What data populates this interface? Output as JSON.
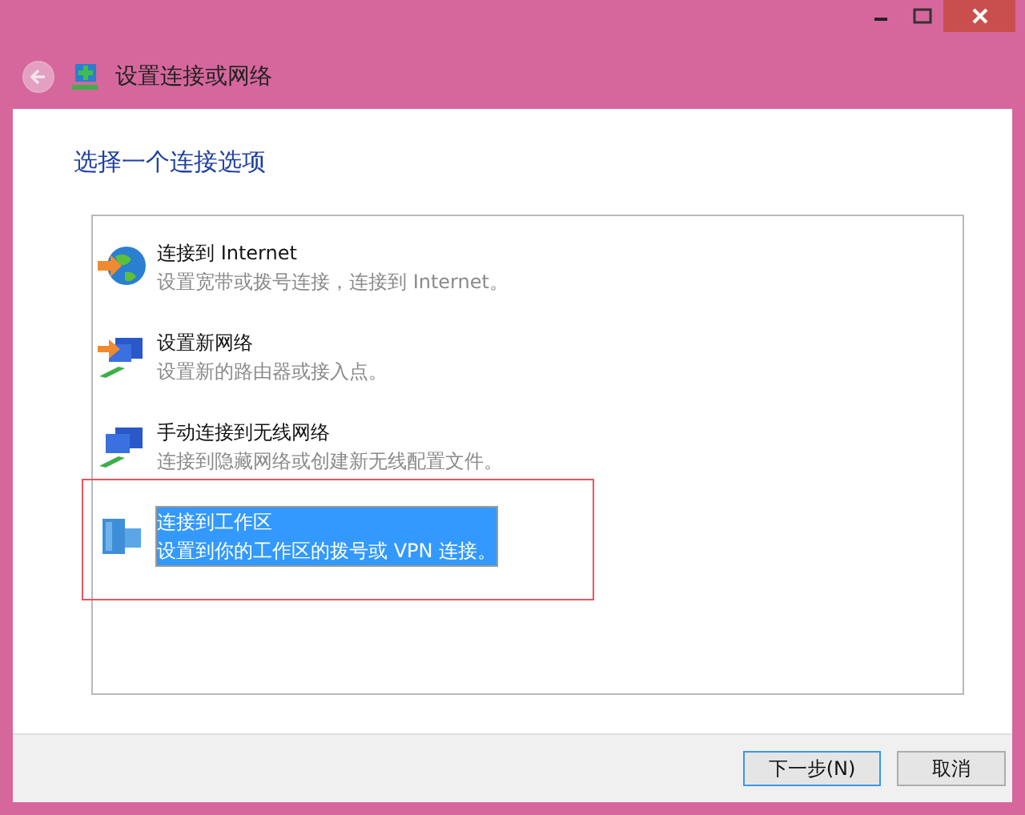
{
  "window": {
    "title": "设置连接或网络"
  },
  "heading": "选择一个连接选项",
  "options": [
    {
      "kind": "internet",
      "title": "连接到 Internet",
      "description": "设置宽带或拨号连接，连接到 Internet。",
      "selected": false,
      "annotated": false
    },
    {
      "kind": "new-network",
      "title": "设置新网络",
      "description": "设置新的路由器或接入点。",
      "selected": false,
      "annotated": false
    },
    {
      "kind": "wireless",
      "title": "手动连接到无线网络",
      "description": "连接到隐藏网络或创建新无线配置文件。",
      "selected": false,
      "annotated": false
    },
    {
      "kind": "workplace",
      "title": "连接到工作区",
      "description": "设置到你的工作区的拨号或 VPN 连接。",
      "selected": true,
      "annotated": true
    }
  ],
  "buttons": [
    {
      "label": "下一步(N)",
      "default": true
    },
    {
      "label": "取消",
      "default": false
    }
  ]
}
